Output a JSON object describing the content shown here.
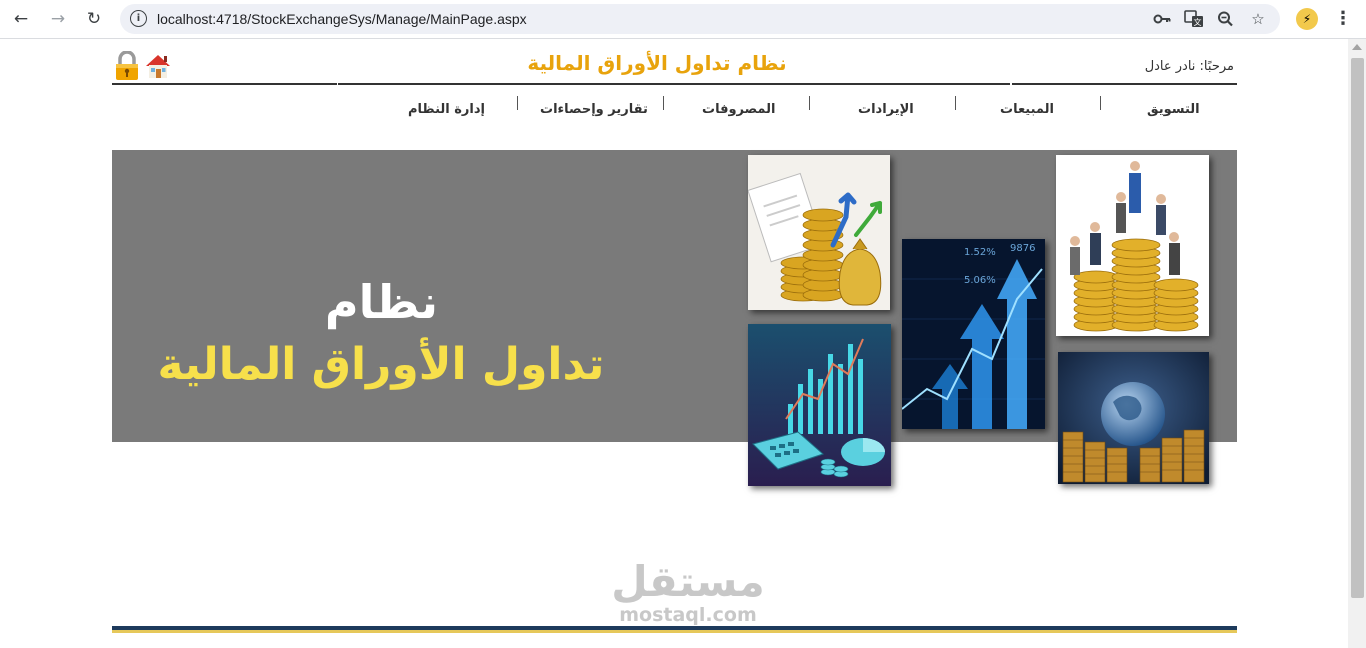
{
  "browser": {
    "url": "localhost:4718/StockExchangeSys/Manage/MainPage.aspx"
  },
  "header": {
    "title": "نظام تداول الأوراق المالية",
    "welcome": "مرحبًا: نادر عادل"
  },
  "menu": {
    "items": [
      {
        "label": "التسويق"
      },
      {
        "label": "المبيعات"
      },
      {
        "label": "الإيرادات"
      },
      {
        "label": "المصروفات"
      },
      {
        "label": "تقارير وإحصاءات"
      },
      {
        "label": "إدارة النظام"
      }
    ]
  },
  "banner": {
    "line1": "نظام",
    "line2": "تداول الأوراق المالية",
    "chart_numbers": [
      "1.52%",
      "9876",
      "5.06%"
    ]
  },
  "watermark": {
    "arabic": "مستقل",
    "latin": "mostaql.com"
  },
  "colors": {
    "title": "#e8a30c",
    "banner_bg": "#7a7a7a",
    "banner_text_yellow": "#f7e04b",
    "footer_navy": "#1d3a5c"
  }
}
